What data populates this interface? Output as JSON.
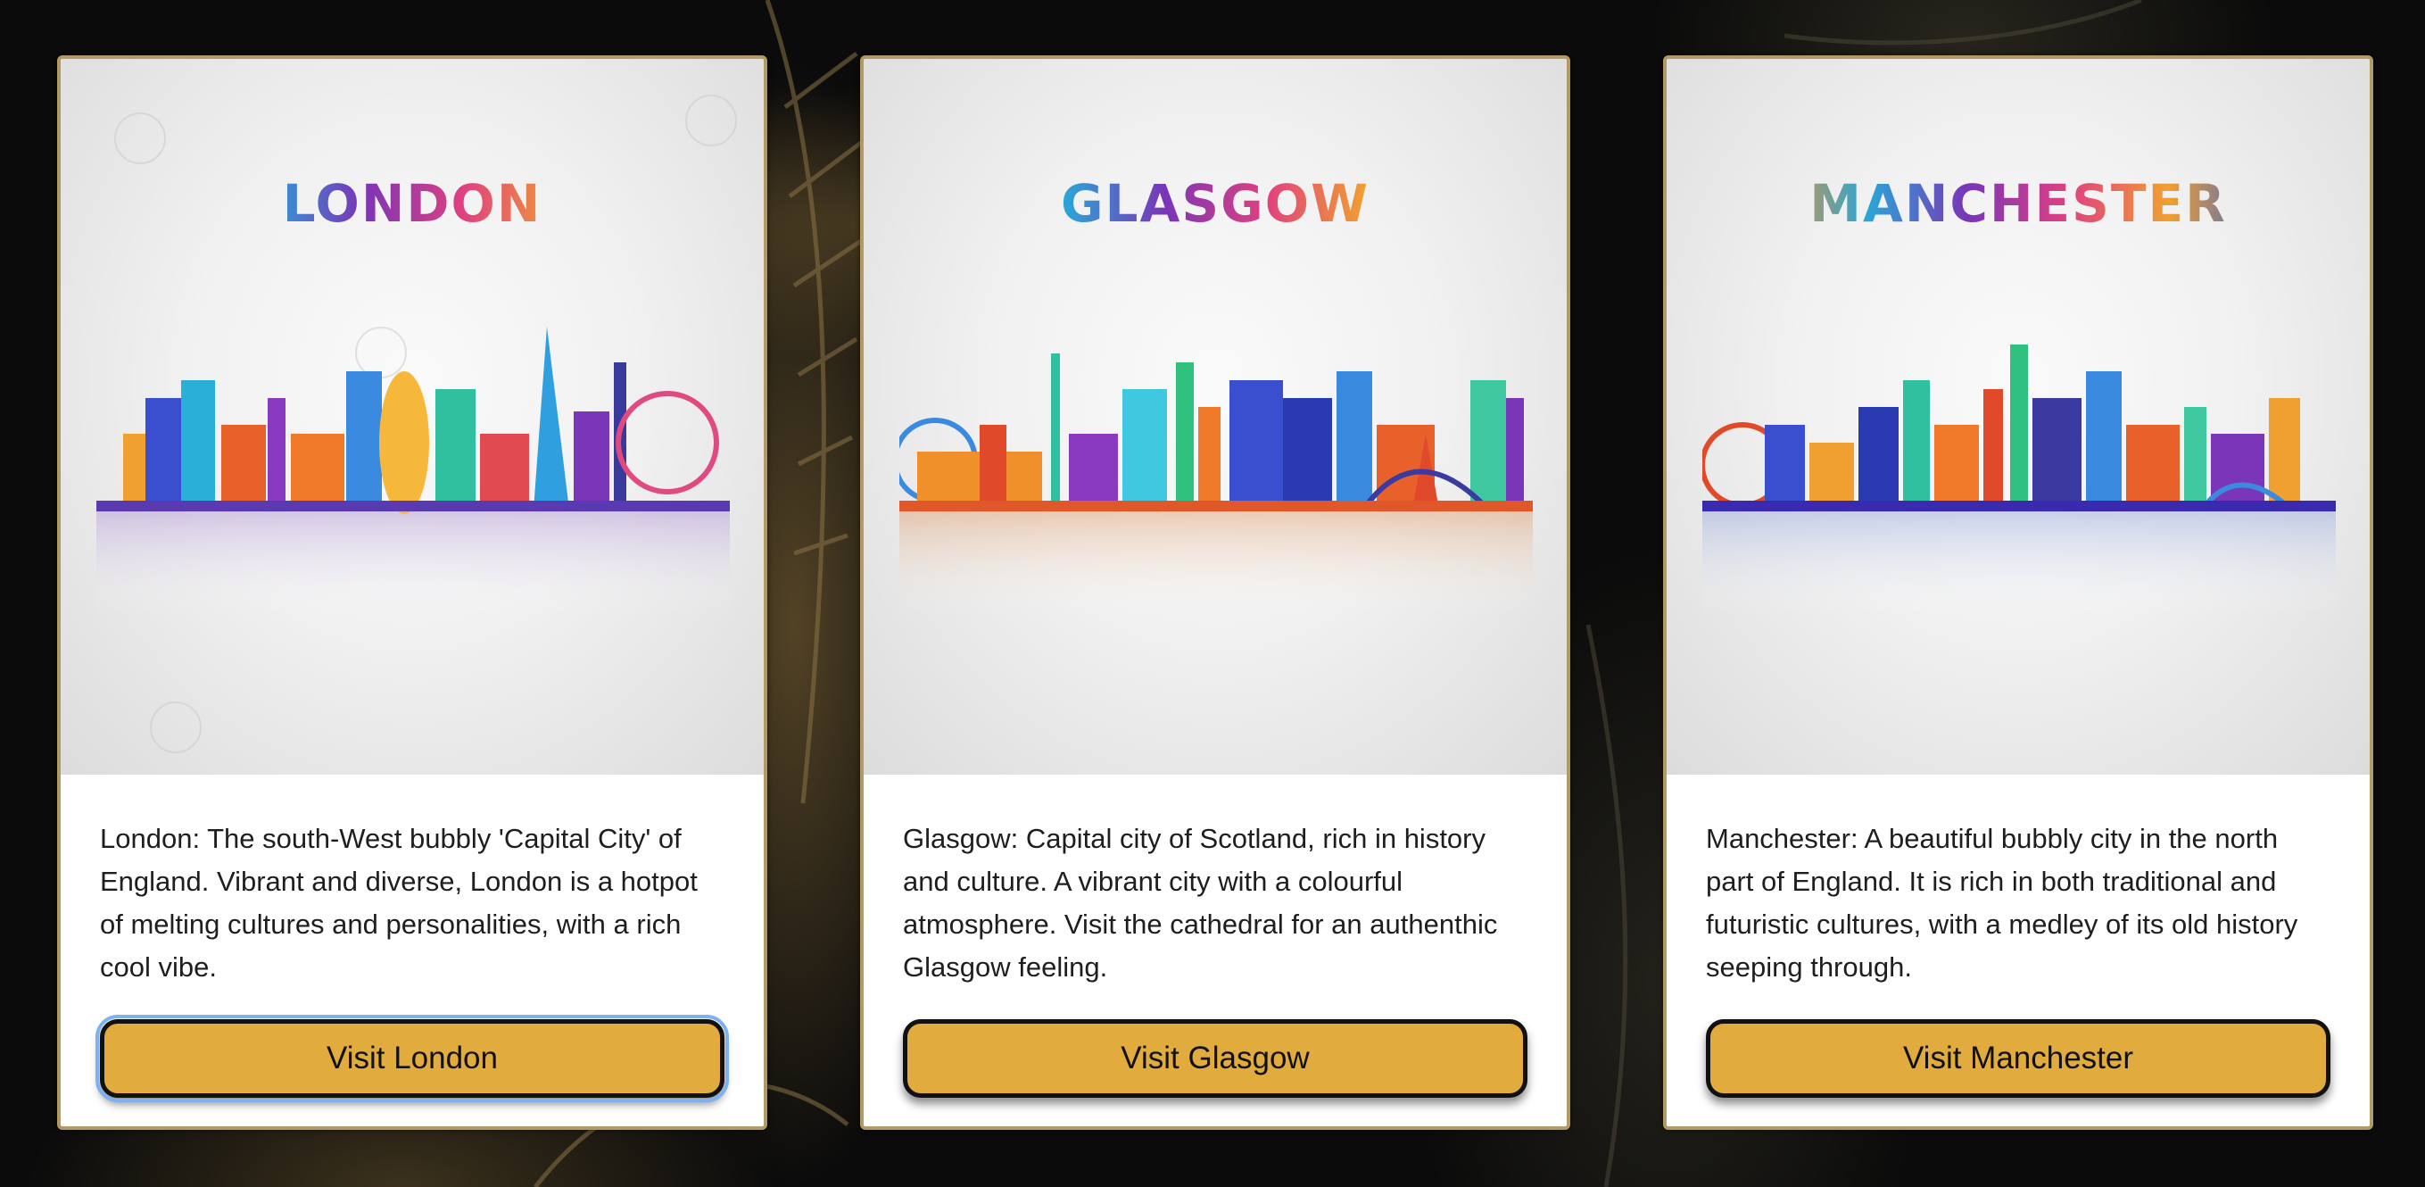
{
  "cards": [
    {
      "title": "LONDON",
      "description": "London: The south-West bubbly 'Capital City' of England. Vibrant and diverse, London is a hotpot of melting cultures and personalities, with a rich cool vibe.",
      "button_label": "Visit London",
      "focused": true
    },
    {
      "title": "GLASGOW",
      "description": "Glasgow: Capital city of Scotland, rich in history and culture. A vibrant city with a colourful atmosphere. Visit the cathedral for an authenthic Glasgow feeling.",
      "button_label": "Visit Glasgow",
      "focused": false
    },
    {
      "title": "MANCHESTER",
      "description": "Manchester: A beautiful bubbly city in the north part of England. It is rich in both traditional and futuristic cultures, with a medley of its old history seeping through.",
      "button_label": "Visit Manchester",
      "focused": false
    }
  ],
  "colors": {
    "button_fill": "#e1ac3d",
    "card_border": "#b39a62",
    "focus_ring": "#7fb0f0",
    "page_background": "#0b0b0b"
  }
}
